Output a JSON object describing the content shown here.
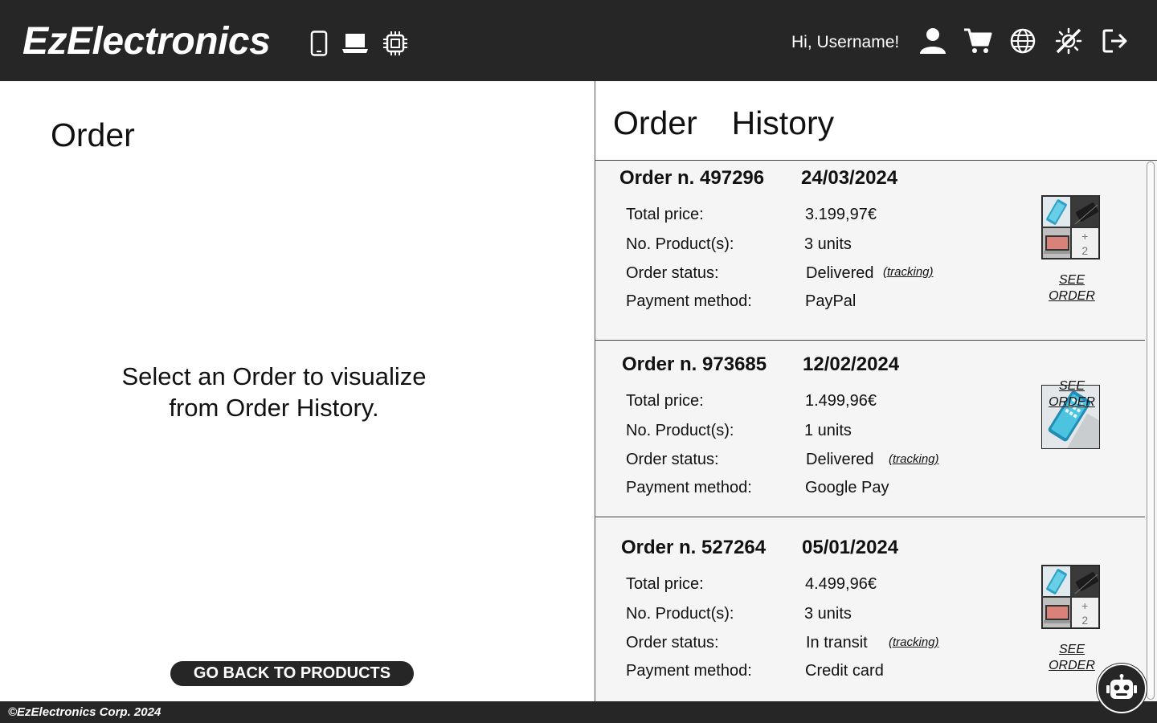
{
  "header": {
    "logo": "EzElectronics",
    "greeting": "Hi, Username!",
    "category_icons": [
      "smartphone-icon",
      "laptop-icon",
      "chip-icon"
    ],
    "action_icons": [
      "user-icon",
      "cart-icon",
      "globe-icon",
      "theme-toggle-icon",
      "logout-icon"
    ]
  },
  "left": {
    "title": "Order",
    "message_line1": "Select an Order to visualize",
    "message_line2": "from Order History.",
    "back_button": "GO BACK TO PRODUCTS"
  },
  "history": {
    "title": "Order  History",
    "labels": {
      "total": "Total price:",
      "products": "No. Product(s):",
      "status": "Order status:",
      "payment": "Payment method:"
    },
    "tracking": "(tracking)",
    "see_order": "SEE ORDER",
    "orders": [
      {
        "number": "Order n. 497296",
        "date": "24/03/2024",
        "total": "3.199,97€",
        "units": "3 units",
        "status": "Delivered",
        "payment": "PayPal",
        "extra": "+",
        "extra_count": "2"
      },
      {
        "number": "Order n. 973685",
        "date": "12/02/2024",
        "total": "1.499,96€",
        "units": "1 units",
        "status": "Delivered",
        "payment": "Google Pay"
      },
      {
        "number": "Order n. 527264",
        "date": "05/01/2024",
        "total": "4.499,96€",
        "units": "3 units",
        "status": "In transit",
        "payment": "Credit card",
        "extra": "+",
        "extra_count": "2"
      }
    ]
  },
  "footer": {
    "text": "©EzElectronics Corp. 2024"
  },
  "colors": {
    "dark": "#262626",
    "panel": "#f5f5f5"
  }
}
